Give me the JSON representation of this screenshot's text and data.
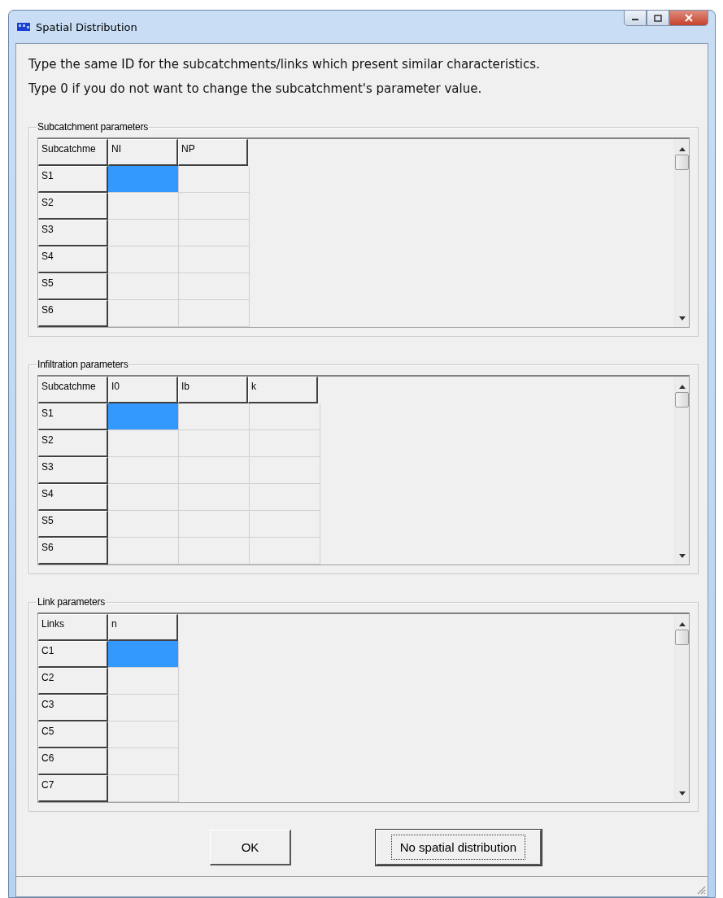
{
  "window": {
    "title": "Spatial Distribution"
  },
  "instructions": [
    "Type the same ID for the subcatchments/links which present similar characteristics.",
    "Type 0 if you do not want to change the subcatchment's parameter value."
  ],
  "groups": [
    {
      "title": "Subcatchment parameters",
      "columns": [
        "Subcatchme",
        "NI",
        "NP"
      ],
      "rows": [
        {
          "label": "S1",
          "cells": [
            {
              "selected": true
            },
            {
              "selected": false
            }
          ]
        },
        {
          "label": "S2",
          "cells": [
            {
              "selected": false
            },
            {
              "selected": false
            }
          ]
        },
        {
          "label": "S3",
          "cells": [
            {
              "selected": false
            },
            {
              "selected": false
            }
          ]
        },
        {
          "label": "S4",
          "cells": [
            {
              "selected": false
            },
            {
              "selected": false
            }
          ]
        },
        {
          "label": "S5",
          "cells": [
            {
              "selected": false
            },
            {
              "selected": false
            }
          ]
        },
        {
          "label": "S6",
          "cells": [
            {
              "selected": false
            },
            {
              "selected": false
            }
          ]
        }
      ]
    },
    {
      "title": "Infiltration parameters",
      "columns": [
        "Subcatchme",
        "I0",
        "Ib",
        "k"
      ],
      "rows": [
        {
          "label": "S1",
          "cells": [
            {
              "selected": true
            },
            {
              "selected": false
            },
            {
              "selected": false
            }
          ]
        },
        {
          "label": "S2",
          "cells": [
            {
              "selected": false
            },
            {
              "selected": false
            },
            {
              "selected": false
            }
          ]
        },
        {
          "label": "S3",
          "cells": [
            {
              "selected": false
            },
            {
              "selected": false
            },
            {
              "selected": false
            }
          ]
        },
        {
          "label": "S4",
          "cells": [
            {
              "selected": false
            },
            {
              "selected": false
            },
            {
              "selected": false
            }
          ]
        },
        {
          "label": "S5",
          "cells": [
            {
              "selected": false
            },
            {
              "selected": false
            },
            {
              "selected": false
            }
          ]
        },
        {
          "label": "S6",
          "cells": [
            {
              "selected": false
            },
            {
              "selected": false
            },
            {
              "selected": false
            }
          ]
        }
      ]
    },
    {
      "title": "Link parameters",
      "columns": [
        "Links",
        "n"
      ],
      "rows": [
        {
          "label": "C1",
          "cells": [
            {
              "selected": true
            }
          ]
        },
        {
          "label": "C2",
          "cells": [
            {
              "selected": false
            }
          ]
        },
        {
          "label": "C3",
          "cells": [
            {
              "selected": false
            }
          ]
        },
        {
          "label": "C5",
          "cells": [
            {
              "selected": false
            }
          ]
        },
        {
          "label": "C6",
          "cells": [
            {
              "selected": false
            }
          ]
        },
        {
          "label": "C7",
          "cells": [
            {
              "selected": false
            }
          ]
        }
      ]
    }
  ],
  "buttons": [
    {
      "label": "OK",
      "focused": false
    },
    {
      "label": "No spatial distribution",
      "focused": true
    }
  ]
}
